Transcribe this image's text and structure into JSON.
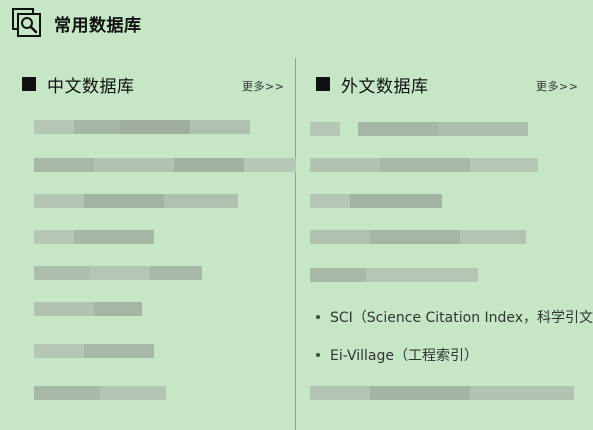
{
  "header": {
    "title": "常用数据库",
    "icon": "database-search-icon"
  },
  "left_panel": {
    "title": "中文数据库",
    "more_label": "更多>>"
  },
  "right_panel": {
    "title": "外文数据库",
    "more_label": "更多>>",
    "items": [
      {
        "label": "SCI（Science Citation Index，科学引文"
      },
      {
        "label": "Ei-Village（工程索引）"
      }
    ]
  },
  "colors": {
    "background": "#c5e7c6",
    "blur_light": "#b3c4b2",
    "blur_dark": "#9aaa99"
  }
}
